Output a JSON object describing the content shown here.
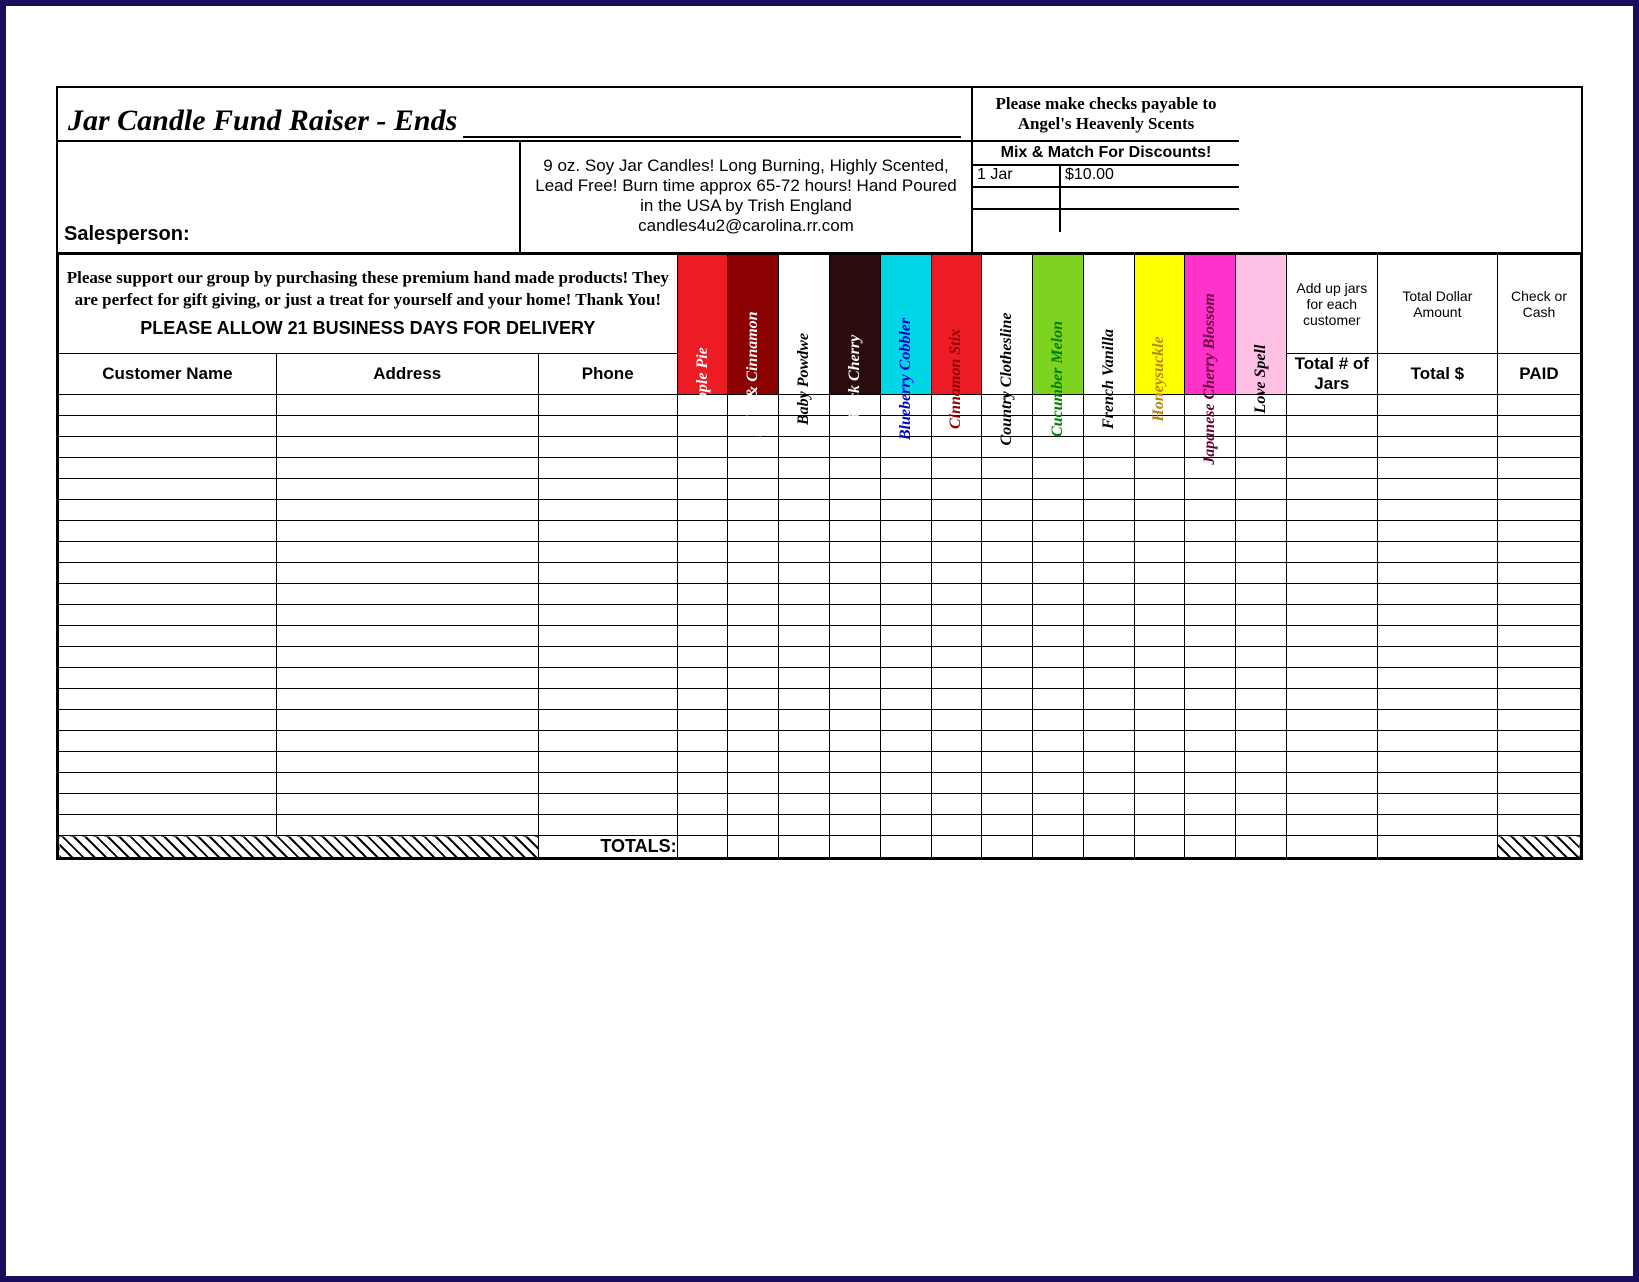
{
  "title_prefix": "Jar Candle Fund Raiser   - Ends",
  "payable": "Please make checks payable to Angel's Heavenly Scents",
  "salesperson_label": "Salesperson:",
  "description": "9 oz. Soy Jar Candles!  Long Burning, Highly Scented, Lead Free!  Burn time approx 65-72 hours!  Hand Poured in the USA by   Trish England",
  "contact_email": "candles4u2@carolina.rr.com",
  "mix_match": "Mix & Match For Discounts!",
  "price_rows": [
    {
      "qty": "1 Jar",
      "price": "$10.00"
    },
    {
      "qty": "",
      "price": ""
    },
    {
      "qty": "",
      "price": ""
    }
  ],
  "support_msg": "Please support our group by purchasing these premium hand made products!  They are perfect for gift giving, or just a treat for yourself and your home!  Thank You!",
  "delivery_note": "PLEASE ALLOW 21 BUSINESS DAYS FOR DELIVERY",
  "cols": {
    "name": "Customer Name",
    "addr": "Address",
    "phone": "Phone"
  },
  "scents": [
    {
      "label": "Apple Pie",
      "bg": "#ed1c24",
      "fg": "#ffffff"
    },
    {
      "label": "Apples & Cinnamon",
      "bg": "#8b0000",
      "fg": "#ffffff"
    },
    {
      "label": "Baby Powdwe",
      "bg": "#ffffff",
      "fg": "#000000"
    },
    {
      "label": "Black Cherry",
      "bg": "#2b0b0b",
      "fg": "#ffffff"
    },
    {
      "label": "Blueberry Cobbler",
      "bg": "#00d7e6",
      "fg": "#0000cc"
    },
    {
      "label": "Cinnamon Stix",
      "bg": "#ed1c24",
      "fg": "#8b0000"
    },
    {
      "label": "Country Clothesline",
      "bg": "#ffffff",
      "fg": "#000000"
    },
    {
      "label": "Cucumber Melon",
      "bg": "#7ed321",
      "fg": "#008000"
    },
    {
      "label": "French Vanilla",
      "bg": "#ffffff",
      "fg": "#000000"
    },
    {
      "label": "Honeysuckle",
      "bg": "#ffff00",
      "fg": "#b8860b"
    },
    {
      "label": "Japanese Cherry Blossom",
      "bg": "#ff33cc",
      "fg": "#660033"
    },
    {
      "label": "Love Spell",
      "bg": "#ffc0e6",
      "fg": "#000000"
    }
  ],
  "sum_headers": {
    "jars_top": "Add up jars for each customer",
    "total_top": "Total Dollar Amount",
    "paid_top": "Check or Cash",
    "jars_sub": "Total # of Jars",
    "total_sub": "Total $",
    "paid_sub": "PAID"
  },
  "data_row_count": 21,
  "totals_label": "TOTALS:"
}
